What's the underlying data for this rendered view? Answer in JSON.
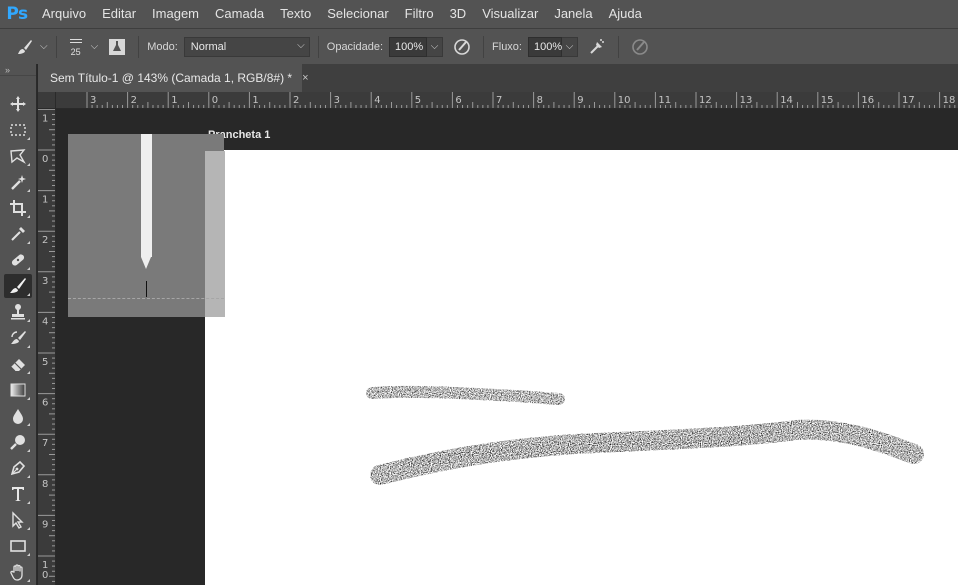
{
  "app": {
    "logo": "Ps"
  },
  "menu": [
    "Arquivo",
    "Editar",
    "Imagem",
    "Camada",
    "Texto",
    "Selecionar",
    "Filtro",
    "3D",
    "Visualizar",
    "Janela",
    "Ajuda"
  ],
  "options": {
    "brush_size": "25",
    "mode_label": "Modo:",
    "mode_value": "Normal",
    "opacity_label": "Opacidade:",
    "opacity_value": "100%",
    "flow_label": "Fluxo:",
    "flow_value": "100%"
  },
  "document": {
    "tab_title": "Sem Título-1 @ 143% (Camada 1, RGB/8#) *",
    "close_glyph": "×",
    "artboard_name": "Prancheta 1"
  },
  "ruler_h": [
    "3",
    "2",
    "1",
    "0",
    "1",
    "2",
    "3",
    "4",
    "5",
    "6",
    "7",
    "8",
    "9",
    "10",
    "11",
    "12",
    "13",
    "14",
    "15",
    "16",
    "17",
    "18"
  ],
  "ruler_v": [
    "1",
    "0",
    "1",
    "2",
    "3",
    "4",
    "5",
    "6",
    "7",
    "8",
    "9",
    "1\n0"
  ],
  "tools": [
    {
      "name": "move-tool",
      "icon": "move-icon"
    },
    {
      "name": "marquee-tool",
      "icon": "marquee-icon"
    },
    {
      "name": "lasso-tool",
      "icon": "lasso-icon"
    },
    {
      "name": "quick-selection-tool",
      "icon": "magic-wand-icon"
    },
    {
      "name": "crop-tool",
      "icon": "crop-icon"
    },
    {
      "name": "eyedropper-tool",
      "icon": "eyedropper-icon"
    },
    {
      "name": "healing-brush-tool",
      "icon": "bandage-icon"
    },
    {
      "name": "brush-tool",
      "icon": "brush-icon",
      "active": true
    },
    {
      "name": "clone-stamp-tool",
      "icon": "stamp-icon"
    },
    {
      "name": "history-brush-tool",
      "icon": "history-brush-icon"
    },
    {
      "name": "eraser-tool",
      "icon": "eraser-icon"
    },
    {
      "name": "gradient-tool",
      "icon": "gradient-icon"
    },
    {
      "name": "blur-tool",
      "icon": "blur-drop-icon"
    },
    {
      "name": "dodge-tool",
      "icon": "dodge-icon"
    },
    {
      "name": "pen-tool",
      "icon": "pen-icon"
    },
    {
      "name": "type-tool",
      "icon": "type-icon"
    },
    {
      "name": "path-selection-tool",
      "icon": "arrow-icon"
    },
    {
      "name": "rectangle-tool",
      "icon": "rectangle-icon"
    },
    {
      "name": "hand-tool",
      "icon": "hand-icon"
    }
  ],
  "colors": {
    "chrome": "#535353",
    "pasteboard": "#282828",
    "accent": "#31a8ff"
  }
}
